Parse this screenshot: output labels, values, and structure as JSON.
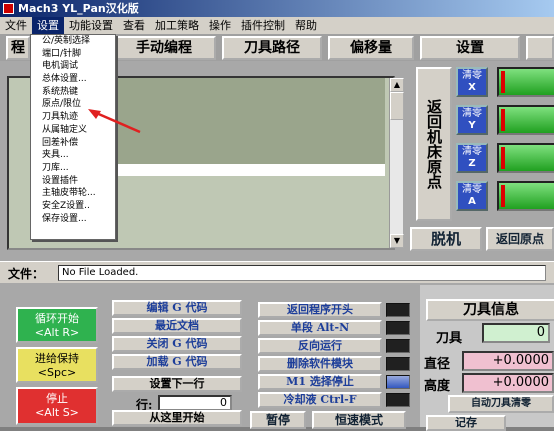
{
  "title": "Mach3  YL_Pan汉化版",
  "menu": [
    "文件",
    "设置",
    "功能设置",
    "查看",
    "加工策略",
    "操作",
    "插件控制",
    "帮助"
  ],
  "tabs": [
    "程",
    "手动编程",
    "刀具路径",
    "偏移量",
    "设置"
  ],
  "dropdown": [
    "公/英制选择",
    "端口/针脚",
    "电机调试",
    "总体设置...",
    "系统热键",
    "原点/限位",
    "刀具轨迹",
    "从属轴定义",
    "回差补偿",
    "夹具...",
    "刀库...",
    "设置插件",
    "主轴皮带轮...",
    "安全Z设置..",
    "保存设置..."
  ],
  "home_button": "返回机床原点",
  "zero_buttons": [
    {
      "top": "清零",
      "axis": "X"
    },
    {
      "top": "清零",
      "axis": "Y"
    },
    {
      "top": "清零",
      "axis": "Z"
    },
    {
      "top": "清零",
      "axis": "A"
    }
  ],
  "offline_button": "脱机",
  "return_origin_button": "返回原点",
  "file": {
    "label": "文件：",
    "value": "No File Loaded."
  },
  "cycle_start": {
    "line1": "循环开始",
    "line2": "<Alt R>"
  },
  "feed_hold": {
    "line1": "进给保持",
    "line2": "<Spc>"
  },
  "stop": {
    "line1": "停止",
    "line2": "<Alt S>"
  },
  "mid_buttons": [
    "编辑 G 代码",
    "最近文档",
    "关闭 G 代码",
    "加载 G 代码",
    "设置下一行"
  ],
  "line_label": "行:",
  "line_value": "0",
  "run_from_here": "从这里开始",
  "mid2_buttons": [
    "返回程序开头",
    "单段 Alt-N",
    "反向运行",
    "删除软件模块",
    "M1 选择停止",
    "冷却液 Ctrl-F"
  ],
  "pause_button": "暂停",
  "constant_mode": "恒速模式",
  "tool_info": {
    "header": "刀具信息",
    "tool_label": "刀具",
    "tool_value": "0",
    "diameter_label": "直径",
    "diameter_value": "+0.0000",
    "height_label": "高度",
    "height_value": "+0.0000",
    "auto_zero": "自动刀具清零",
    "save_button": "记存"
  },
  "colors": {
    "accent": "#0a246a",
    "zero": "#3050c0",
    "green": "#20a020",
    "cycle": "#2fb24f",
    "hold": "#e8e060",
    "stop": "#e03030"
  }
}
